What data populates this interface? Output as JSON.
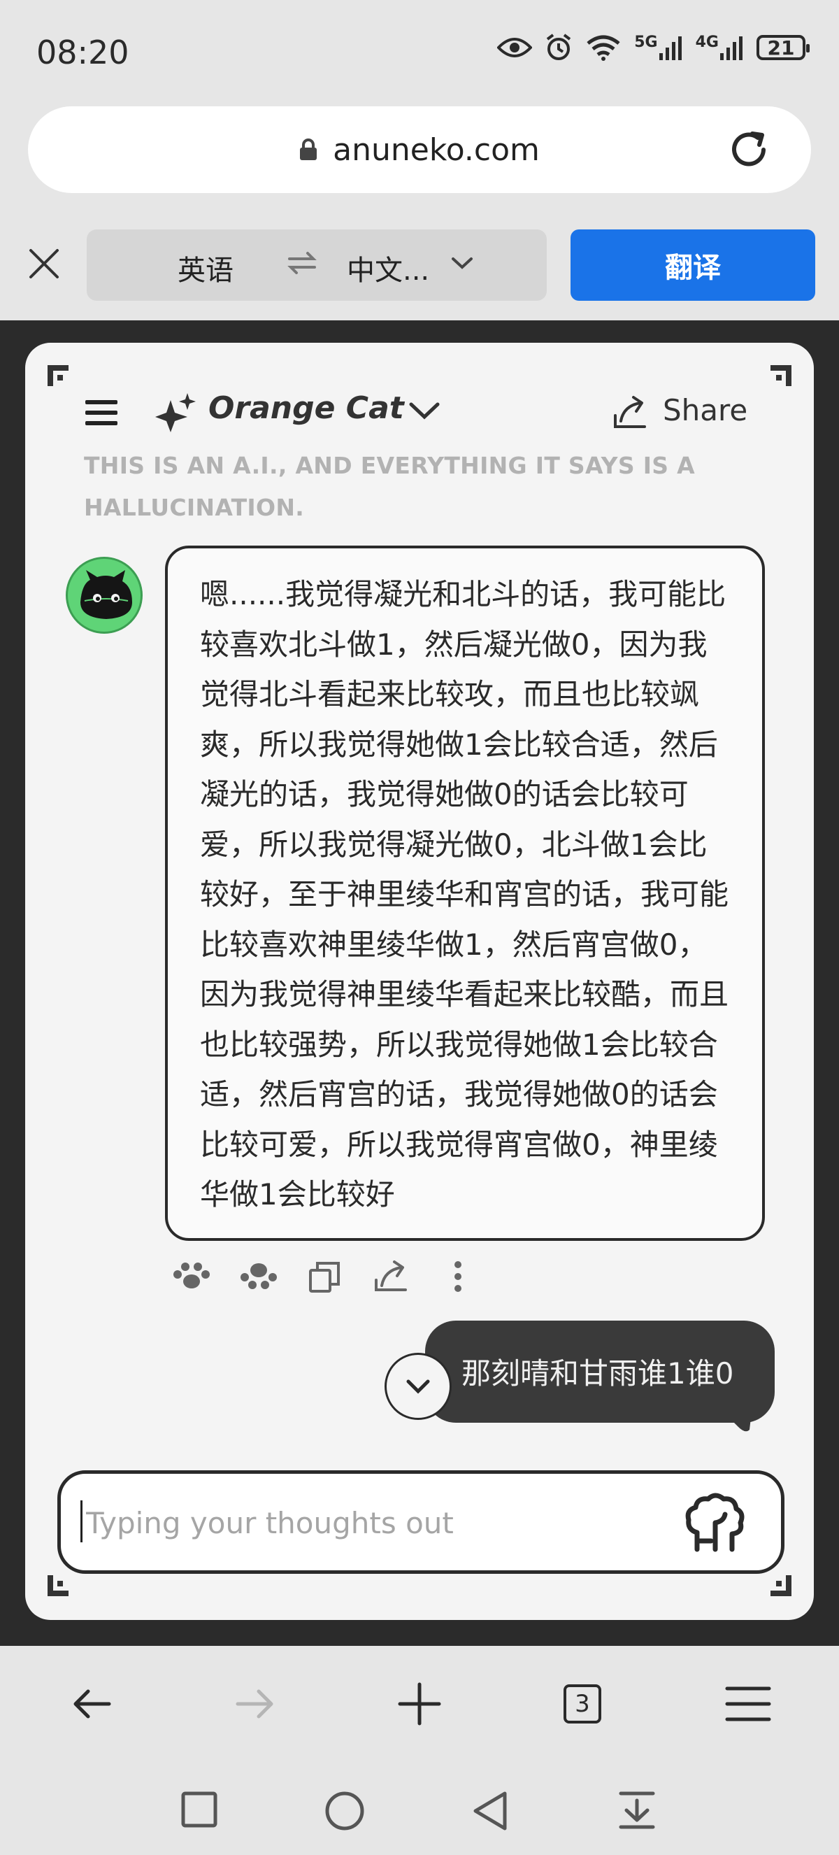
{
  "status_bar": {
    "time": "08:20",
    "network_5g": "5G",
    "network_4g": "4G",
    "battery": "21"
  },
  "url_bar": {
    "domain": "anuneko.com"
  },
  "translate_bar": {
    "source_lang": "英语",
    "target_lang": "中文...",
    "translate_label": "翻译",
    "accent_color": "#1a73e8"
  },
  "chat": {
    "model_name": "Orange Cat",
    "share_label": "Share",
    "disclaimer": "THIS IS AN A.I., AND EVERYTHING IT SAYS IS A HALLUCINATION.",
    "assistant_message": "嗯......我觉得凝光和北斗的话，我可能比较喜欢北斗做1，然后凝光做0，因为我觉得北斗看起来比较攻，而且也比较飒爽，所以我觉得她做1会比较合适，然后凝光的话，我觉得她做0的话会比较可爱，所以我觉得凝光做0，北斗做1会比较好，至于神里绫华和宵宫的话，我可能比较喜欢神里绫华做1，然后宵宫做0，因为我觉得神里绫华看起来比较酷，而且也比较强势，所以我觉得她做1会比较合适，然后宵宫的话，我觉得她做0的话会比较可爱，所以我觉得宵宫做0，神里绫华做1会比较好",
    "message_actions": [
      "paw-icon",
      "paws-icon",
      "copy-icon",
      "share-icon",
      "more-icon"
    ],
    "user_message": "那刻晴和甘雨谁1谁0",
    "input_placeholder": "Typing your thoughts out"
  },
  "browser_nav": {
    "tabs_count": "3"
  }
}
